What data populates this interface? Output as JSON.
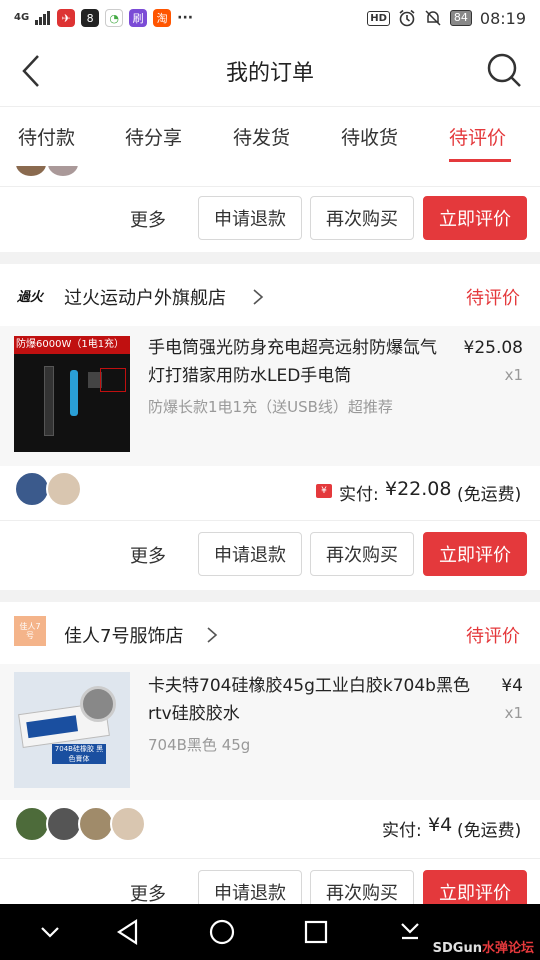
{
  "status_bar": {
    "signal": "4G",
    "hd": "HD",
    "battery": "84",
    "time": "08:19",
    "app_icons": [
      "app-icon",
      "app-icon",
      "app-icon",
      "app-icon",
      "app-icon"
    ],
    "more": "···"
  },
  "header": {
    "title": "我的订单"
  },
  "tabs": [
    {
      "label": "待付款",
      "active": false
    },
    {
      "label": "待分享",
      "active": false
    },
    {
      "label": "待发货",
      "active": false
    },
    {
      "label": "待收货",
      "active": false
    },
    {
      "label": "待评价",
      "active": true
    }
  ],
  "actions": {
    "more": "更多",
    "refund": "申请退款",
    "rebuy": "再次购买",
    "review": "立即评价"
  },
  "orders": [
    {
      "shop": "过火运动户外旗舰店",
      "shop_logo_text": "過火",
      "status": "待评价",
      "product": {
        "name": "手电筒强光防身充电超亮远射防爆氙气灯打猎家用防水LED手电筒",
        "sku": "防爆长款1电1充（送USB线）超推荐",
        "price": "¥25.08",
        "qty": "x1",
        "image_text": "防爆6000W（1电1充）"
      },
      "paid_label": "实付:",
      "paid_amount": "¥22.08",
      "shipping": "(免运费)"
    },
    {
      "shop": "佳人7号服饰店",
      "shop_logo_text": "佳人7号",
      "status": "待评价",
      "product": {
        "name": "卡夫特704硅橡胶45g工业白胶k704b黑色rtv硅胶胶水",
        "sku": "704B黑色 45g",
        "price": "¥4",
        "qty": "x1",
        "image_text": "704B硅橡胶 黑色膏体"
      },
      "paid_label": "实付:",
      "paid_amount": "¥4",
      "shipping": "(免运费)"
    }
  ],
  "watermark": {
    "text": "SDGun",
    "text_red": "水弹论坛"
  },
  "colors": {
    "accent": "#e4393c",
    "text": "#222222",
    "muted": "#999999"
  }
}
